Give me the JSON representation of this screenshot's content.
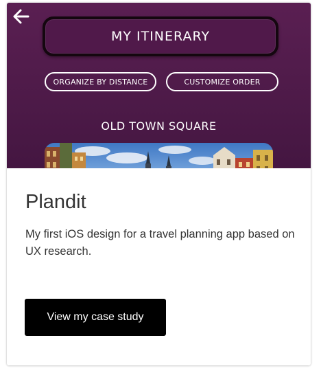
{
  "hero": {
    "title": "MY ITINERARY",
    "buttons": [
      "ORGANIZE BY DISTANCE",
      "CUSTOMIZE ORDER"
    ],
    "place": "OLD TOWN SQUARE",
    "back_icon": "back-arrow-icon",
    "background_color": "#4f1a4a"
  },
  "card": {
    "title": "Plandit",
    "description": "My first iOS design for a travel planning app based on UX research.",
    "cta_label": "View my case study",
    "cta_color": "#000000"
  }
}
